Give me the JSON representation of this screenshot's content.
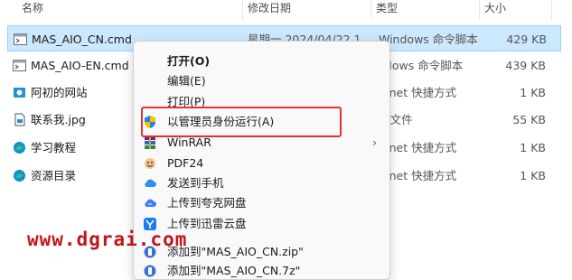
{
  "columns": {
    "name": "名称",
    "date": "修改日期",
    "type": "类型",
    "size": "大小"
  },
  "files": [
    {
      "icon": "cmd-file-icon",
      "name": "MAS_AIO_CN.cmd",
      "date": "星期一 2024/04/22 1...",
      "type": "Windows 命令脚本",
      "size": "429 KB",
      "selected": true
    },
    {
      "icon": "cmd-file-icon",
      "name": "MAS_AIO-EN.cmd",
      "date": "",
      "type": "ndows 命令脚本",
      "size": "439 KB"
    },
    {
      "icon": "internet-shortcut-icon",
      "name": "阿初的网站",
      "date": "",
      "type": "ernet 快捷方式",
      "size": "1 KB"
    },
    {
      "icon": "jpg-file-icon",
      "name": "联系我.jpg",
      "date": "",
      "type": "G 文件",
      "size": "55 KB"
    },
    {
      "icon": "edge-shortcut-icon",
      "name": "学习教程",
      "date": "",
      "type": "ernet 快捷方式",
      "size": "1 KB"
    },
    {
      "icon": "edge-shortcut-icon",
      "name": "资源目录",
      "date": "",
      "type": "ernet 快捷方式",
      "size": "1 KB"
    }
  ],
  "context_menu": {
    "items": [
      {
        "label": "打开(O)",
        "icon": "",
        "bold": true
      },
      {
        "label": "编辑(E)",
        "icon": ""
      },
      {
        "label": "打印(P)",
        "icon": ""
      },
      {
        "label": "以管理员身份运行(A)",
        "icon": "uac-shield-icon"
      },
      {
        "label": "WinRAR",
        "icon": "winrar-icon",
        "submenu": true
      },
      {
        "label": "PDF24",
        "icon": "pdf24-icon"
      },
      {
        "label": "发送到手机",
        "icon": "cloud-icon"
      },
      {
        "label": "上传到夸克网盘",
        "icon": "cloud-icon"
      },
      {
        "label": "上传到迅雷云盘",
        "icon": "xunlei-icon"
      },
      {
        "label": "添加到\"MAS_AIO_CN.zip\"",
        "icon": "archive-icon"
      },
      {
        "label": "添加到\"MAS_AIO_CN.7z\"",
        "icon": "archive-icon"
      }
    ]
  },
  "watermark": "www.dgrai.com",
  "colors": {
    "selection": "#cce8ff",
    "highlight_border": "#e0332e",
    "watermark": "#c0161b"
  }
}
